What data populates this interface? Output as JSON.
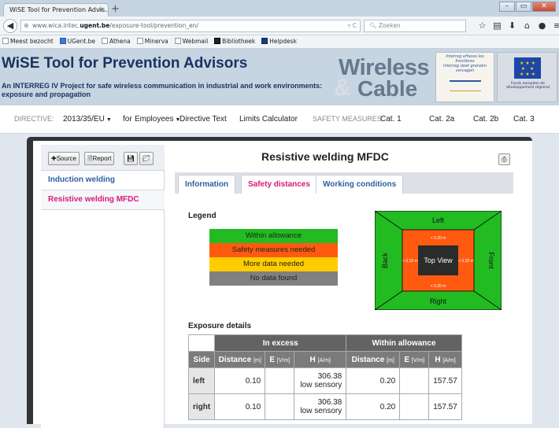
{
  "browser": {
    "tab_title": "WiSE Tool for Prevention Advis...",
    "tab_close": "×",
    "new_tab": "+",
    "url_prefix": "www.wica.intec.",
    "url_domain": "ugent.be",
    "url_path": "/exposure-tool/prevention_en/",
    "search_placeholder": "Zoeken",
    "bookmarks": [
      "Meest bezocht",
      "UGent.be",
      "Athena",
      "Minerva",
      "Webmail",
      "Bibliotheek",
      "Helpdesk"
    ]
  },
  "banner": {
    "title": "WiSE Tool for Prevention Advisors",
    "subtitle": "An INTERREG IV Project for safe wireless communication in industrial and work environments: exposure and propagation",
    "logo_word1": "Wireless",
    "logo_amp": "&",
    "logo_word2": "Cable",
    "interreg_line1": "Interreg effaces les frontières",
    "interreg_line2": "Interreg doet grenzen vervagen",
    "eu_text": "Fonds européen de développement régional"
  },
  "directive_bar": {
    "directive_label": "DIRECTIVE:",
    "directive_value": "2013/35/EU",
    "for_label": "for",
    "audience_value": "Employees",
    "directive_text": "Directive Text",
    "limits_calculator": "Limits Calculator",
    "safety_label": "SAFETY MEASURES:",
    "cats": [
      "Cat. 1",
      "Cat. 2a",
      "Cat. 2b",
      "Cat. 3"
    ]
  },
  "sidebar": {
    "buttons": {
      "source": "Source",
      "report": "Report"
    },
    "items": [
      "Induction welding",
      "Resistive welding MFDC"
    ]
  },
  "content": {
    "title": "Resistive welding MFDC",
    "tabs": [
      "Information",
      "Safety distances",
      "Working conditions"
    ],
    "legend_title": "Legend",
    "legend": [
      {
        "label": "Within allowance",
        "color": "#22bb22"
      },
      {
        "label": "Safety measures needed",
        "color": "#ff5a10"
      },
      {
        "label": "More data needed",
        "color": "#ffcc00"
      },
      {
        "label": "No data found",
        "color": "#808080"
      }
    ],
    "topview": {
      "left": "Left",
      "right": "Right",
      "back": "Back",
      "front": "Front",
      "center": "Top View",
      "d_top": "< 0.20 m",
      "d_bottom": "< 0.20 m",
      "d_left": "< 0.20 m",
      "d_right": "< 0.20 m"
    },
    "exposure_title": "Exposure details",
    "table": {
      "group_excess": "In excess",
      "group_within": "Within allowance",
      "col_side": "Side",
      "col_distance": "Distance",
      "unit_m": "[m]",
      "col_e": "E",
      "unit_e": "[V/m]",
      "col_h": "H",
      "unit_h": "[A/m]",
      "rows": [
        {
          "side": "left",
          "ex_dist": "0.10",
          "ex_e": "",
          "ex_h": "306.38",
          "ex_h_note": "low sensory",
          "in_dist": "0.20",
          "in_e": "",
          "in_h": "157.57"
        },
        {
          "side": "right",
          "ex_dist": "0.10",
          "ex_e": "",
          "ex_h": "306.38",
          "ex_h_note": "low sensory",
          "in_dist": "0.20",
          "in_e": "",
          "in_h": "157.57"
        }
      ]
    }
  },
  "colors": {
    "accent_blue": "#2e5da0",
    "accent_pink": "#d61a7a",
    "banner": "#c7d4e2"
  }
}
